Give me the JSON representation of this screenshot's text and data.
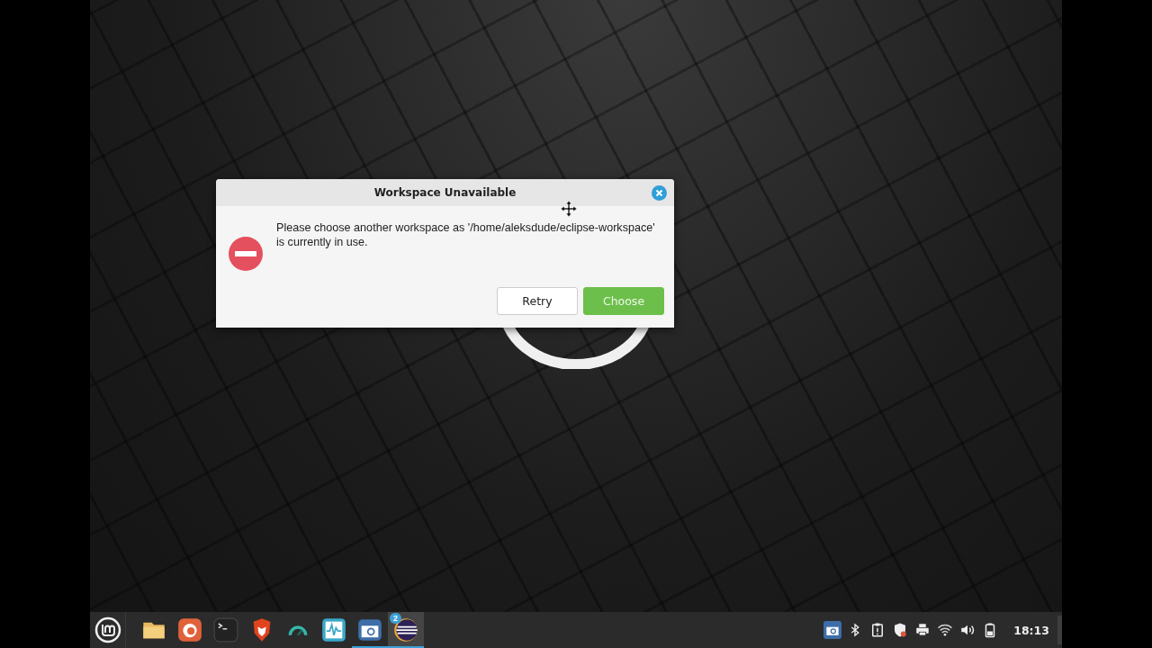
{
  "dialog": {
    "title": "Workspace Unavailable",
    "message": "Please choose another workspace as '/home/aleksdude/eclipse-workspace' is currently in use.",
    "buttons": [
      {
        "label": "Retry",
        "kind": "default"
      },
      {
        "label": "Choose",
        "kind": "suggested"
      }
    ]
  },
  "taskbar": {
    "launchers": [
      {
        "kind": "folder",
        "running": false,
        "active": false
      },
      {
        "kind": "firefox",
        "running": false,
        "active": false
      },
      {
        "kind": "terminal",
        "running": false,
        "active": false
      },
      {
        "kind": "brave",
        "running": false,
        "active": false
      },
      {
        "kind": "gauge",
        "running": false,
        "active": false
      },
      {
        "kind": "monitor",
        "running": false,
        "active": false
      },
      {
        "kind": "camera",
        "running": true,
        "active": false
      },
      {
        "kind": "eclipse",
        "running": true,
        "active": true,
        "badge": "2"
      }
    ],
    "tray": [
      {
        "kind": "camera"
      },
      {
        "kind": "bluetooth"
      },
      {
        "kind": "clipboard"
      },
      {
        "kind": "shield"
      },
      {
        "kind": "printer"
      },
      {
        "kind": "wifi"
      },
      {
        "kind": "volume"
      },
      {
        "kind": "battery"
      }
    ],
    "clock": "18:13"
  }
}
